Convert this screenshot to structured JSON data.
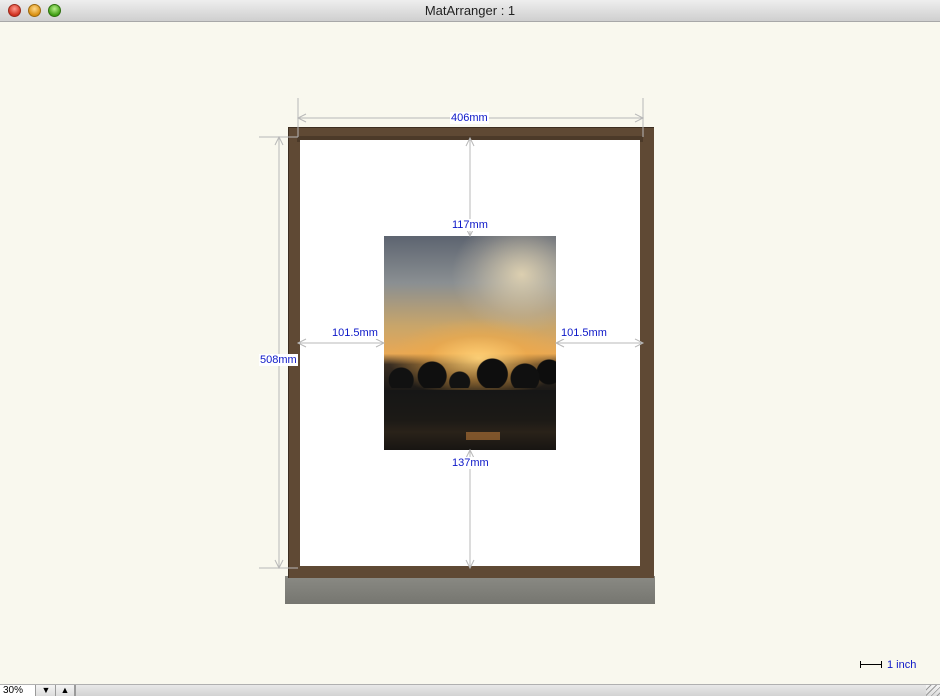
{
  "window": {
    "title": "MatArranger : 1",
    "controls": [
      "close-icon",
      "minimize-icon",
      "zoom-icon"
    ]
  },
  "frame": {
    "frame_color": "#5f4934",
    "mat_color": "#ffffff"
  },
  "dimensions": {
    "frame_width": "406mm",
    "frame_height": "508mm",
    "top_margin": "117mm",
    "bottom_margin": "137mm",
    "left_margin": "101.5mm",
    "right_margin": "101.5mm",
    "label_color": "#0c17c8"
  },
  "scale": {
    "label": "1 inch"
  },
  "statusbar": {
    "zoom_value": "30%",
    "zoom_down_icon": "triangle-down-icon",
    "zoom_up_icon": "triangle-up-icon"
  }
}
